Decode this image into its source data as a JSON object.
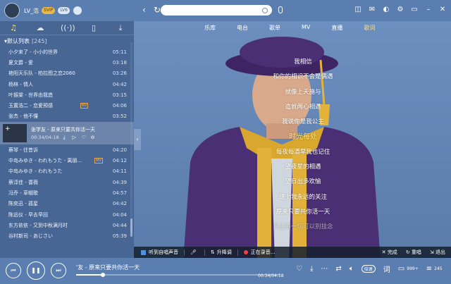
{
  "user": {
    "name": "LV_浩",
    "svip": "SVIP",
    "level": "LV6"
  },
  "search": {
    "placeholder": ""
  },
  "sidebar": {
    "list_title": "默认列表",
    "list_count": "[245]",
    "songs": [
      {
        "title": "小夕来了 - 小小的世界",
        "dur": "05:11"
      },
      {
        "title": "夏文爵 - 爱",
        "dur": "03:18"
      },
      {
        "title": "艳阳天乐队 - 柏拉图之恋2060",
        "dur": "03:26"
      },
      {
        "title": "杨林 - 情人",
        "dur": "04:42"
      },
      {
        "title": "叶振棠 - 世界由我造",
        "dur": "03:15"
      },
      {
        "title": "玉置浩二 - 恋爱预感",
        "dur": "04:06",
        "tag": "MV"
      },
      {
        "title": "张杰 - 他不懂",
        "dur": "03:52"
      }
    ],
    "current": {
      "title": "张学友 - 原来只要共你活一天",
      "time": "00:34/04:18"
    },
    "songs2": [
      {
        "title": "蔡琴 - 往昔诉",
        "dur": "04:20"
      },
      {
        "title": "中岛みゆき - われもうた - 离朋...",
        "dur": "04:12",
        "tag": "MV"
      },
      {
        "title": "中岛みゆき - われもうた",
        "dur": "04:11"
      },
      {
        "title": "蔡淳佳 - 薔薇",
        "dur": "04:39"
      },
      {
        "title": "冯乔 - 草帽歌",
        "dur": "04:57"
      },
      {
        "title": "陈奕迅 - 孤星",
        "dur": "04:42"
      },
      {
        "title": "陈远仪 - 早去早回",
        "dur": "04:04"
      },
      {
        "title": "东方依依 - 又到中秋满月时",
        "dur": "04:44"
      },
      {
        "title": "谷村新司 - あじさい",
        "dur": "05:39"
      }
    ]
  },
  "topnav": [
    "乐库",
    "电台",
    "歌单",
    "MV",
    "直播",
    "歌词"
  ],
  "lyrics": [
    "我相信",
    "和你的相识不会是偶遇",
    "就像上天施与",
    "造就两心相遇",
    "我说你是我公主",
    "时光每处",
    "每夜每清早我也记住",
    "望夜星的相遇",
    "望日出多欢愉",
    "送上我永远的关注",
    "原来只要共你活一天",
    "凡尘俗一切可以别挂念"
  ],
  "karaoke": {
    "listen": "听到自唱声音",
    "tune": "升降调",
    "recording": "正在录音...",
    "done": "完成",
    "redo": "重唱",
    "exit": "退出"
  },
  "player": {
    "now_playing": "'友 - 原来只要共你活一天",
    "time": "00:34/04:18",
    "progress": 0.13,
    "speed": "倍速",
    "comment_count": "999+",
    "queue_count": "245",
    "word": "词"
  },
  "colors": {
    "bg": "#5b7eb0",
    "accent": "#ffe066"
  }
}
